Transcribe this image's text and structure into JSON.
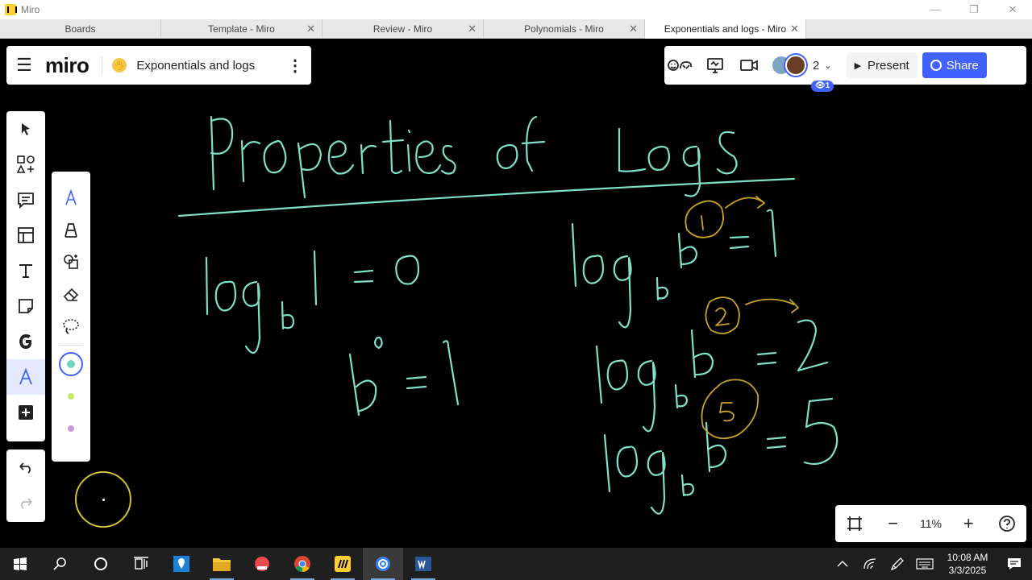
{
  "window": {
    "title": "Miro",
    "min": "—",
    "restore": "❐",
    "close": "✕"
  },
  "tabs": [
    {
      "label": "Boards",
      "closable": false
    },
    {
      "label": "Template - Miro",
      "closable": true
    },
    {
      "label": "Review - Miro",
      "closable": true
    },
    {
      "label": "Polynomials - Miro",
      "closable": true
    },
    {
      "label": "Exponentials and logs - Miro",
      "closable": true,
      "active": true
    }
  ],
  "tab_close_glyph": "✕",
  "header": {
    "logo_text": "miro",
    "board_name": "Exponentials and logs",
    "menu_glyph": "☰",
    "more_glyph": "⋮"
  },
  "collab": {
    "participants_count": "2",
    "viewer_badge": "1",
    "present_label": "Present",
    "share_label": "Share",
    "accent": "#4262ff"
  },
  "toolbar": {
    "tools": [
      "select-tool",
      "templates-tool",
      "comment-tool",
      "frame-tool",
      "text-tool",
      "sticky-note-tool",
      "google-tool",
      "pen-tool",
      "more-tools"
    ],
    "selected": "pen-tool"
  },
  "pen_panel": {
    "tools": [
      "pen",
      "highlighter",
      "smart-drawing",
      "eraser",
      "lasso"
    ],
    "colors": [
      "#6fd4bd",
      "#c8e56a",
      "#c79ad8"
    ],
    "selected_color": 0
  },
  "zoom": {
    "value": "11%"
  },
  "canvas": {
    "ink_color_main": "#7fe0c8",
    "ink_color_accent": "#c9a227"
  },
  "taskbar": {
    "time": "10:08 AM",
    "date": "3/3/2025"
  }
}
